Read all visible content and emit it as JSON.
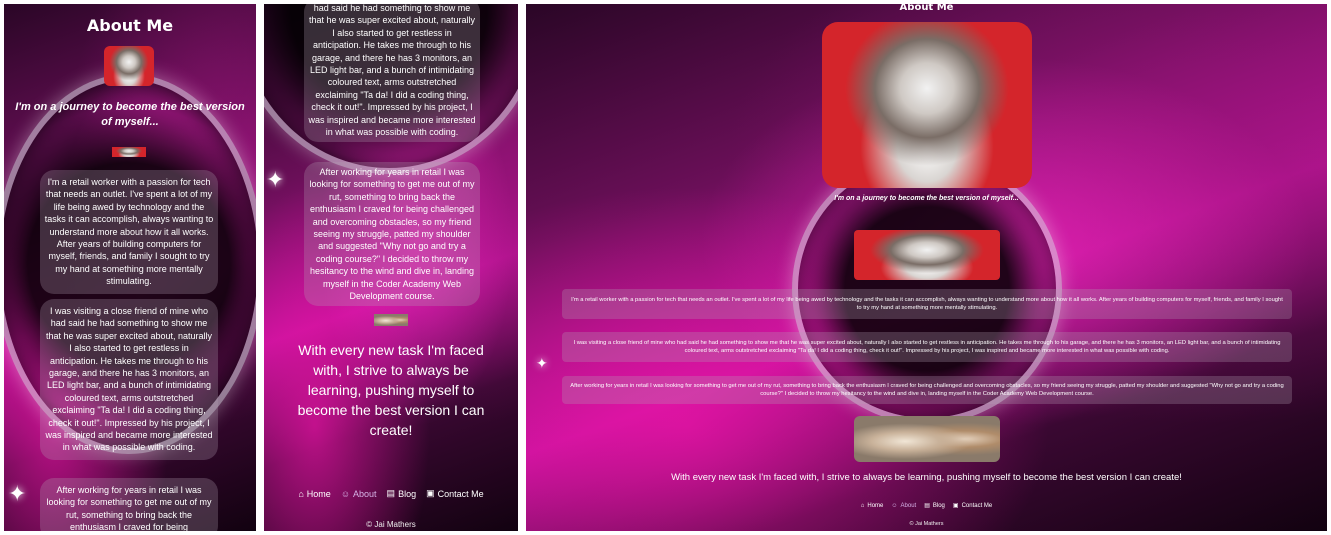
{
  "heading": "About Me",
  "tagline": "I'm on a journey to become the best version of myself...",
  "paragraphs": [
    "I'm a retail worker with a passion for tech that needs an outlet. I've spent a lot of my life being awed by technology and the tasks it can accomplish, always wanting to understand more about how it all works. After years of building computers for myself, friends, and family I sought to try my hand at something more mentally stimulating.",
    "I was visiting a close friend of mine who had said he had something to show me that he was super excited about, naturally I also started to get restless in anticipation. He takes me through to his garage, and there he has 3 monitors, an LED light bar, and a bunch of intimidating coloured text, arms outstretched exclaiming \"Ta da! I did a coding thing, check it out!\". Impressed by his project, I was inspired and became more interested in what was possible with coding.",
    "After working for years in retail I was looking for something to get me out of my rut, something to bring back the enthusiasm I craved for being challenged and overcoming obstacles, so my friend seeing my struggle, patted my shoulder and suggested \"Why not go and try a coding course?\" I decided to throw my hesitancy to the wind and dive in, landing myself in the Coder Academy Web Development course."
  ],
  "mobile_p2_partial": "had said he had something to show me that he was super excited about, naturally I also started to get restless in anticipation. He takes me through to his garage, and there he has 3 monitors, an LED light bar, and a bunch of intimidating coloured text, arms outstretched exclaiming \"Ta da! I did a coding thing, check it out!\". Impressed by his project, I was inspired and became more interested in what was possible with coding.",
  "mobile_p3_partial": "After working for years in retail I was looking for something to get me out of my rut, something to bring back the enthusiasm I craved for being",
  "closing": "With every new task I'm faced with, I strive to always be learning, pushing myself to become the best version I can create!",
  "nav": {
    "home": "Home",
    "about": "About",
    "blog": "Blog",
    "contact": "Contact Me"
  },
  "icons": {
    "home": "home-icon",
    "about": "user-icon",
    "blog": "blog-icon",
    "contact": "contact-icon"
  },
  "footer": "© Jai Mathers",
  "colors": {
    "accent": "#c0139a",
    "active_nav": "#d6b3e6"
  }
}
